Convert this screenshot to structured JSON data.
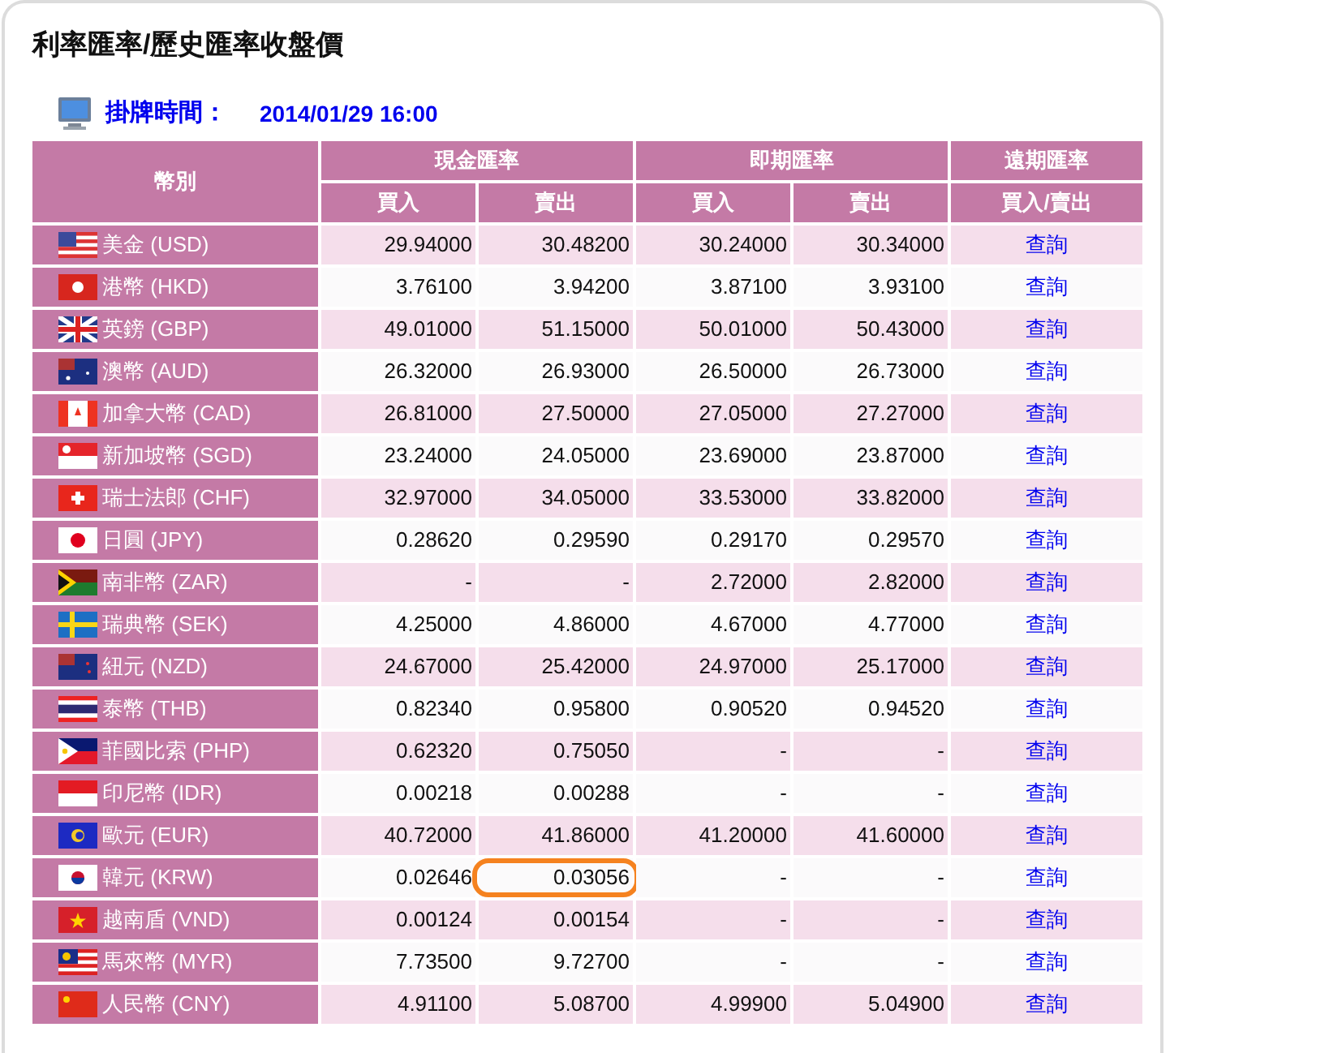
{
  "title": "利率匯率/歷史匯率收盤價",
  "posted": {
    "label": "掛牌時間：",
    "value": "2014/01/29 16:00"
  },
  "table": {
    "columns": {
      "currency": "幣別",
      "cash": "現金匯率",
      "spot": "即期匯率",
      "forward": "遠期匯率",
      "cash_buy": "買入",
      "cash_sell": "賣出",
      "spot_buy": "買入",
      "spot_sell": "賣出",
      "forward_sub": "買入/賣出"
    },
    "rows": [
      {
        "currency": "美金 (USD)",
        "cash_buy": "29.94000",
        "cash_sell": "30.48200",
        "spot_buy": "30.24000",
        "spot_sell": "30.34000",
        "link": "查詢",
        "circled": false
      },
      {
        "currency": "港幣 (HKD)",
        "cash_buy": "3.76100",
        "cash_sell": "3.94200",
        "spot_buy": "3.87100",
        "spot_sell": "3.93100",
        "link": "查詢",
        "circled": false
      },
      {
        "currency": "英鎊 (GBP)",
        "cash_buy": "49.01000",
        "cash_sell": "51.15000",
        "spot_buy": "50.01000",
        "spot_sell": "50.43000",
        "link": "查詢",
        "circled": false
      },
      {
        "currency": "澳幣 (AUD)",
        "cash_buy": "26.32000",
        "cash_sell": "26.93000",
        "spot_buy": "26.50000",
        "spot_sell": "26.73000",
        "link": "查詢",
        "circled": false
      },
      {
        "currency": "加拿大幣 (CAD)",
        "cash_buy": "26.81000",
        "cash_sell": "27.50000",
        "spot_buy": "27.05000",
        "spot_sell": "27.27000",
        "link": "查詢",
        "circled": false
      },
      {
        "currency": "新加坡幣 (SGD)",
        "cash_buy": "23.24000",
        "cash_sell": "24.05000",
        "spot_buy": "23.69000",
        "spot_sell": "23.87000",
        "link": "查詢",
        "circled": false
      },
      {
        "currency": "瑞士法郎 (CHF)",
        "cash_buy": "32.97000",
        "cash_sell": "34.05000",
        "spot_buy": "33.53000",
        "spot_sell": "33.82000",
        "link": "查詢",
        "circled": false
      },
      {
        "currency": "日圓 (JPY)",
        "cash_buy": "0.28620",
        "cash_sell": "0.29590",
        "spot_buy": "0.29170",
        "spot_sell": "0.29570",
        "link": "查詢",
        "circled": false
      },
      {
        "currency": "南非幣 (ZAR)",
        "cash_buy": "-",
        "cash_sell": "-",
        "spot_buy": "2.72000",
        "spot_sell": "2.82000",
        "link": "查詢",
        "circled": false
      },
      {
        "currency": "瑞典幣 (SEK)",
        "cash_buy": "4.25000",
        "cash_sell": "4.86000",
        "spot_buy": "4.67000",
        "spot_sell": "4.77000",
        "link": "查詢",
        "circled": false
      },
      {
        "currency": "紐元 (NZD)",
        "cash_buy": "24.67000",
        "cash_sell": "25.42000",
        "spot_buy": "24.97000",
        "spot_sell": "25.17000",
        "link": "查詢",
        "circled": false
      },
      {
        "currency": "泰幣 (THB)",
        "cash_buy": "0.82340",
        "cash_sell": "0.95800",
        "spot_buy": "0.90520",
        "spot_sell": "0.94520",
        "link": "查詢",
        "circled": false
      },
      {
        "currency": "菲國比索 (PHP)",
        "cash_buy": "0.62320",
        "cash_sell": "0.75050",
        "spot_buy": "-",
        "spot_sell": "-",
        "link": "查詢",
        "circled": false
      },
      {
        "currency": "印尼幣 (IDR)",
        "cash_buy": "0.00218",
        "cash_sell": "0.00288",
        "spot_buy": "-",
        "spot_sell": "-",
        "link": "查詢",
        "circled": false
      },
      {
        "currency": "歐元 (EUR)",
        "cash_buy": "40.72000",
        "cash_sell": "41.86000",
        "spot_buy": "41.20000",
        "spot_sell": "41.60000",
        "link": "查詢",
        "circled": false
      },
      {
        "currency": "韓元 (KRW)",
        "cash_buy": "0.02646",
        "cash_sell": "0.03056",
        "spot_buy": "-",
        "spot_sell": "-",
        "link": "查詢",
        "circled": true
      },
      {
        "currency": "越南盾 (VND)",
        "cash_buy": "0.00124",
        "cash_sell": "0.00154",
        "spot_buy": "-",
        "spot_sell": "-",
        "link": "查詢",
        "circled": false
      },
      {
        "currency": "馬來幣 (MYR)",
        "cash_buy": "7.73500",
        "cash_sell": "9.72700",
        "spot_buy": "-",
        "spot_sell": "-",
        "link": "查詢",
        "circled": false
      },
      {
        "currency": "人民幣 (CNY)",
        "cash_buy": "4.91100",
        "cash_sell": "5.08700",
        "spot_buy": "4.99900",
        "spot_sell": "5.04900",
        "link": "查詢",
        "circled": false
      }
    ]
  }
}
